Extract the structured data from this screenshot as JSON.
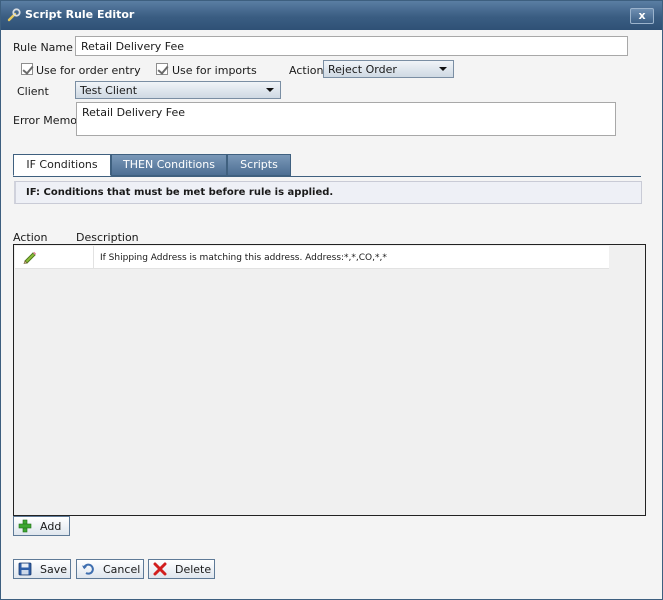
{
  "window": {
    "title": "Script Rule Editor",
    "close_label": "x"
  },
  "form": {
    "rule_name_label": "Rule Name",
    "rule_name_value": "Retail Delivery Fee",
    "use_order_entry_label": "Use for order entry",
    "use_imports_label": "Use for imports",
    "action_label": "Action",
    "action_value": "Reject Order",
    "client_label": "Client",
    "client_value": "Test Client",
    "error_memo_label": "Error Memo",
    "error_memo_value": "Retail Delivery Fee"
  },
  "tabs": [
    {
      "label": "IF Conditions",
      "active": true
    },
    {
      "label": "THEN Conditions",
      "active": false
    },
    {
      "label": "Scripts",
      "active": false
    }
  ],
  "banner": {
    "text": "IF: Conditions that must be met before rule is applied."
  },
  "grid": {
    "columns": [
      "Action",
      "Description"
    ],
    "rows": [
      {
        "description": "If Shipping Address is matching this address. Address:*,*,CO,*,*"
      }
    ]
  },
  "buttons": {
    "add": "Add",
    "save": "Save",
    "cancel": "Cancel",
    "delete": "Delete"
  },
  "icons": {
    "title": "wrench-icon",
    "row_edit": "pencil-icon",
    "add": "plus-icon",
    "save": "floppy-disk-icon",
    "cancel": "undo-icon",
    "delete": "red-x-icon"
  }
}
